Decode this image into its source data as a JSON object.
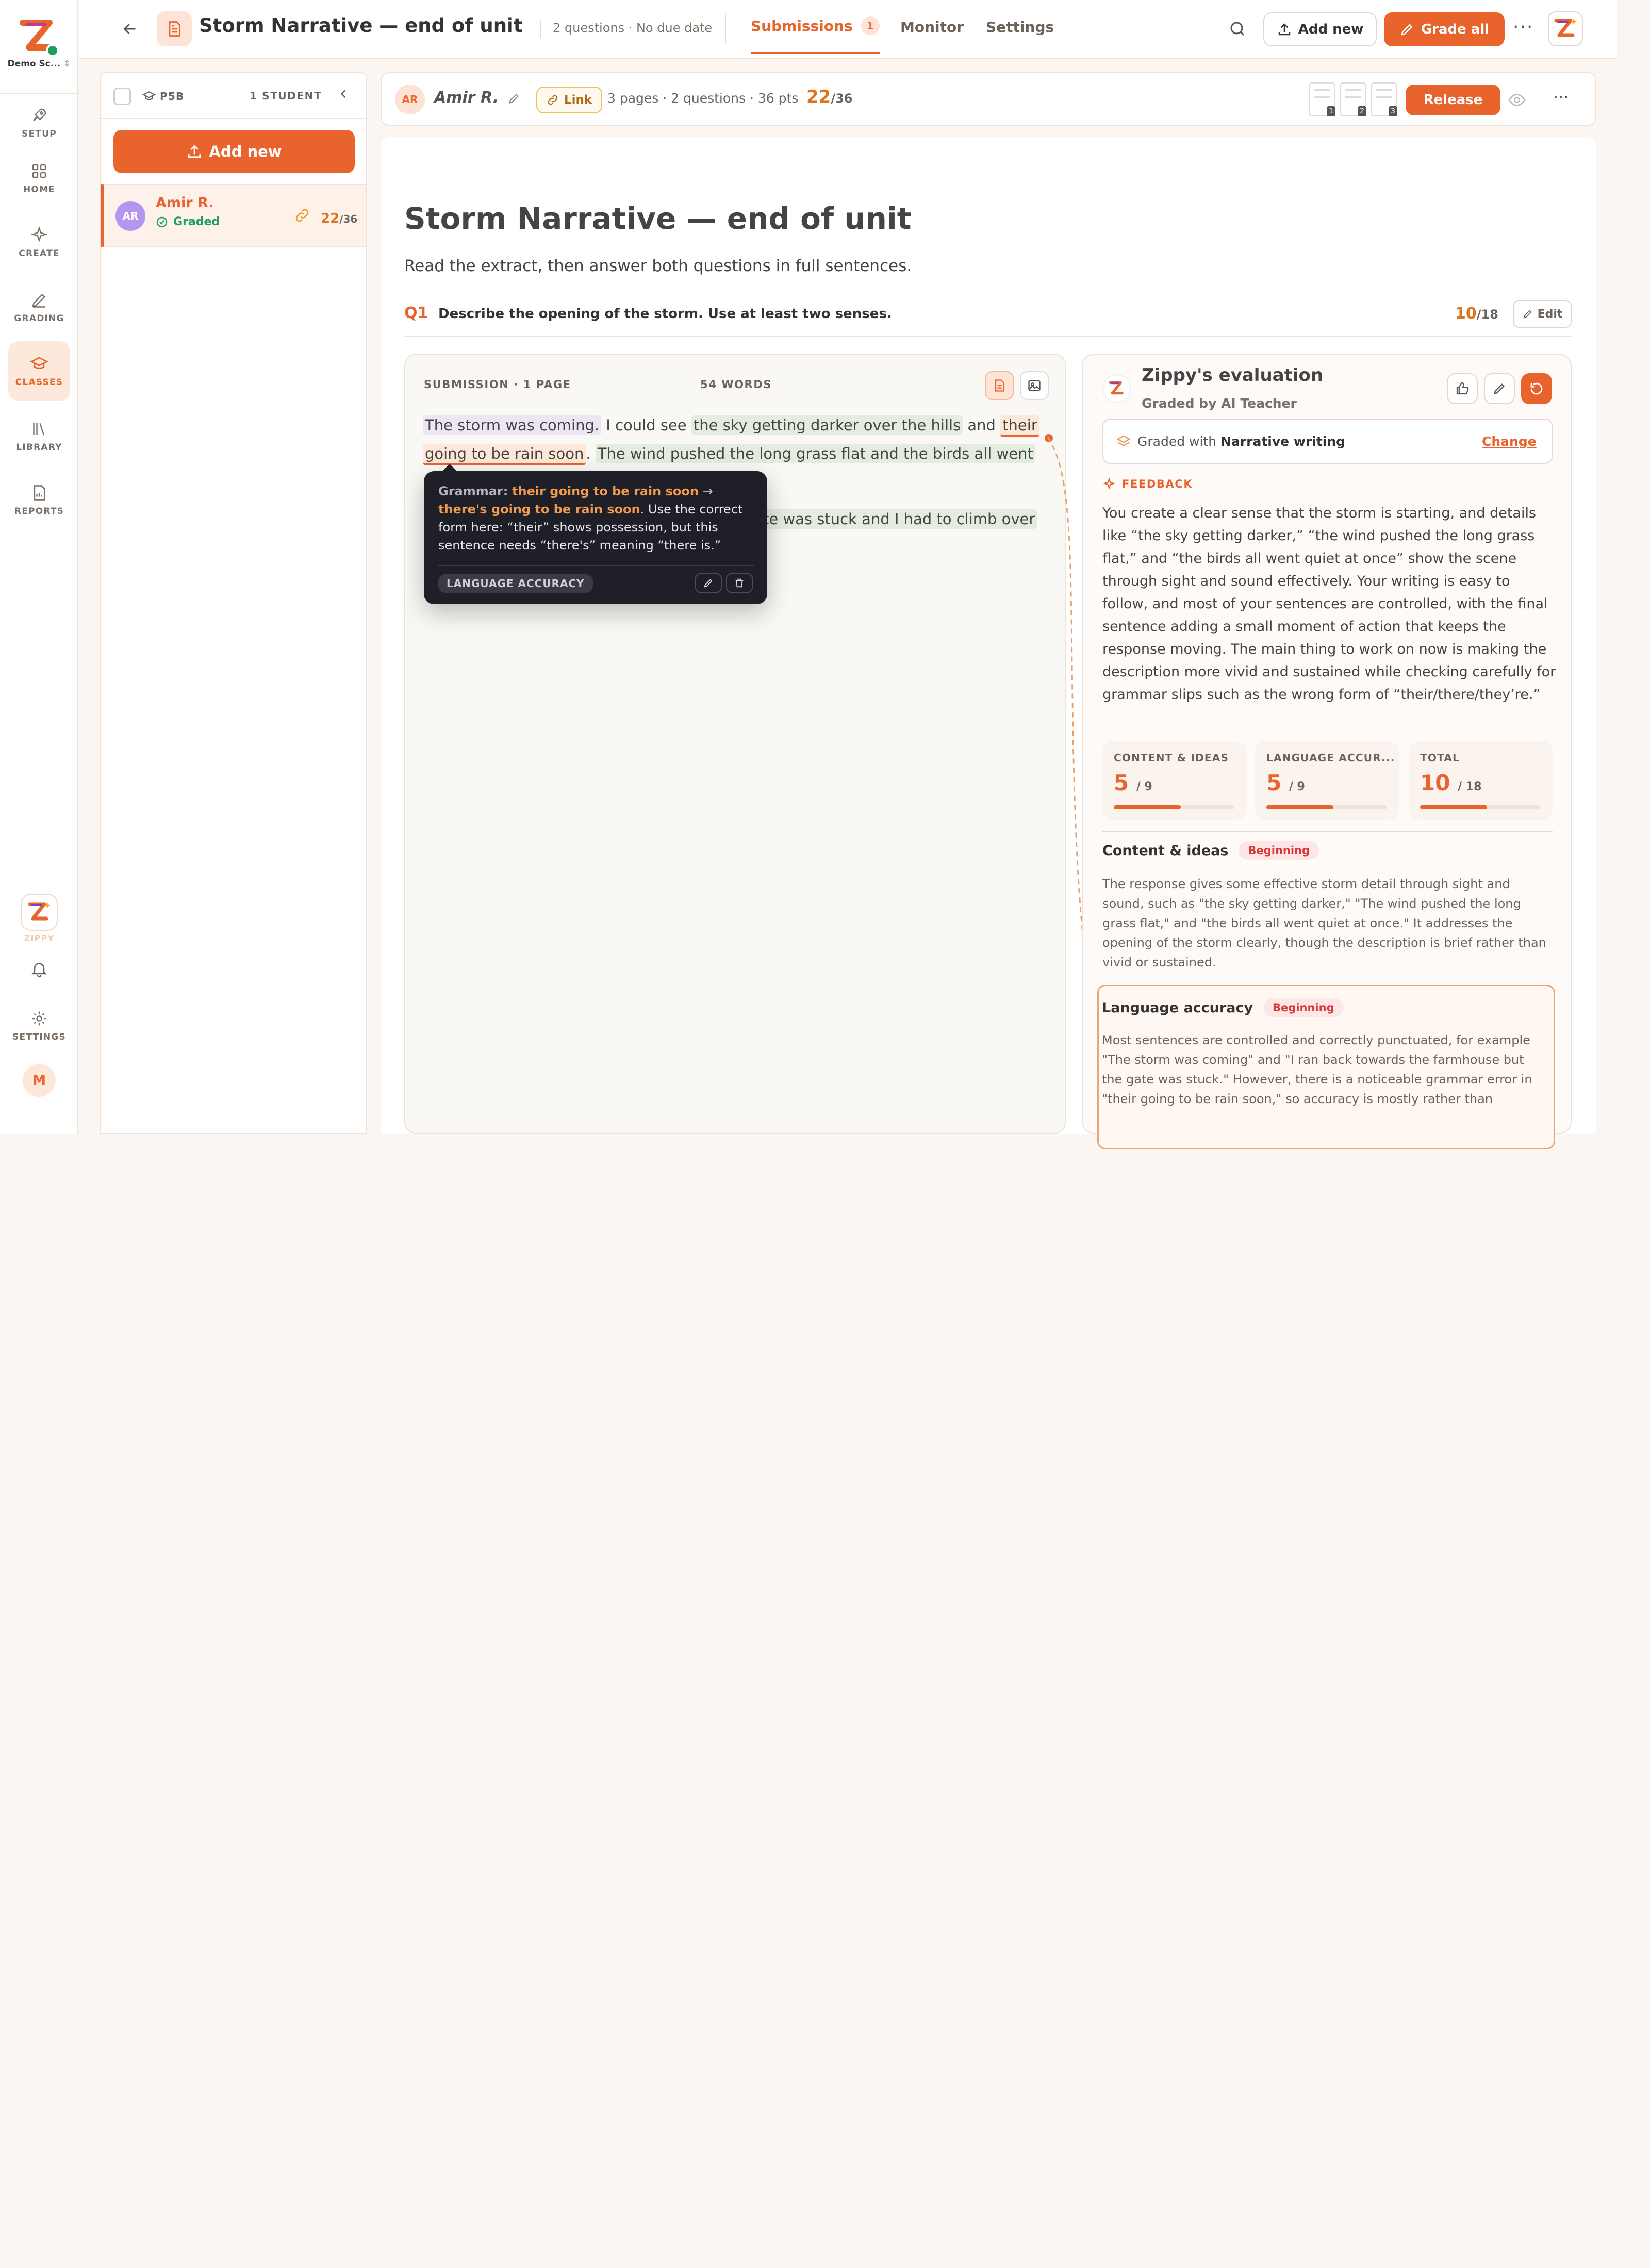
{
  "rail": {
    "org": "Demo Sc...",
    "items": [
      {
        "label": "SETUP",
        "icon": "rocket-icon"
      },
      {
        "label": "HOME",
        "icon": "grid-icon"
      },
      {
        "label": "CREATE",
        "icon": "sparkle-icon"
      },
      {
        "label": "GRADING",
        "icon": "pen-icon"
      },
      {
        "label": "CLASSES",
        "icon": "graduation-cap-icon"
      },
      {
        "label": "LIBRARY",
        "icon": "books-icon"
      },
      {
        "label": "REPORTS",
        "icon": "report-icon"
      }
    ],
    "zippy_label": "ZIPPY",
    "settings_label": "SETTINGS",
    "user_initial": "M"
  },
  "header": {
    "title": "Storm Narrative — end of unit",
    "meta": "2 questions · No due date",
    "tabs": [
      {
        "label": "Submissions",
        "count": "1"
      },
      {
        "label": "Monitor"
      },
      {
        "label": "Settings"
      }
    ],
    "add_new": "Add new",
    "grade_all": "Grade all"
  },
  "students": {
    "class": "P5B",
    "count": "1 STUDENT",
    "add_new": "Add new",
    "list": [
      {
        "initials": "AR",
        "name": "Amir R.",
        "status": "Graded",
        "score": "22",
        "total": "/36"
      }
    ]
  },
  "submission_bar": {
    "initials": "AR",
    "name": "Amir R.",
    "link_label": "Link",
    "meta": "3 pages · 2 questions · 36 pts",
    "score": "22",
    "total": "/36",
    "pages": [
      "1",
      "2",
      "3"
    ],
    "release": "Release"
  },
  "document": {
    "title": "Storm Narrative — end of unit",
    "instructions": "Read the extract, then answer both questions in full sentences.",
    "question_num": "Q1",
    "question_text": "Describe the opening of the storm. Use at least two senses.",
    "q_score": "10",
    "q_total": "/18",
    "edit": "Edit"
  },
  "submission": {
    "label": "SUBMISSION · 1 PAGE",
    "words": "54 WORDS",
    "text": {
      "s1": "The storm was coming.",
      "s2": "I could see",
      "s3": "the sky getting darker over the hills",
      "s4": "and",
      "s5": "their",
      "s6": "going to be rain soon",
      "s7": ".",
      "s8": "The wind pushed the long grass flat and the birds all went",
      "s9": "te was stuck and I had to climb over"
    }
  },
  "tooltip": {
    "prefix": "Grammar:",
    "wrong": "their going to be rain soon",
    "arrow": "→",
    "right": "there's going to be rain soon",
    "explanation": ". Use the correct form here: “their” shows possession, but this sentence needs “there's” meaning “there is.”",
    "tag": "LANGUAGE ACCURACY"
  },
  "evaluation": {
    "title": "Zippy's evaluation",
    "subtitle": "Graded by AI Teacher",
    "rubric_prefix": "Graded with",
    "rubric_name": "Narrative writing",
    "change": "Change",
    "feedback_label": "FEEDBACK",
    "feedback": "You create a clear sense that the storm is starting, and details like “the sky getting darker,” “the wind pushed the long grass flat,” and “the birds all went quiet at once” show the scene through sight and sound effectively. Your writing is easy to follow, and most of your sentences are controlled, with the final sentence adding a small moment of action that keeps the response moving. The main thing to work on now is making the description more vivid and sustained while checking carefully for grammar slips such as the wrong form of “their/there/they’re.”",
    "scores": [
      {
        "label": "CONTENT & IDEAS",
        "value": "5",
        "max": "/ 9",
        "fraction": 0.556
      },
      {
        "label": "LANGUAGE ACCUR...",
        "value": "5",
        "max": "/ 9",
        "fraction": 0.556
      },
      {
        "label": "TOTAL",
        "value": "10",
        "max": "/ 18",
        "fraction": 0.556
      }
    ],
    "criteria": [
      {
        "name": "Content & ideas",
        "level": "Beginning",
        "text": "The response gives some effective storm detail through sight and sound, such as \"the sky getting darker,\" \"The wind pushed the long grass flat,\" and \"the birds all went quiet at once.\" It addresses the opening of the storm clearly, though the description is brief rather than vivid or sustained."
      },
      {
        "name": "Language accuracy",
        "level": "Beginning",
        "text": "Most sentences are controlled and correctly punctuated, for example \"The storm was coming\" and \"I ran back towards the farmhouse but the gate was stuck.\" However, there is a noticeable grammar error in \"their going to be rain soon,\" so accuracy is mostly rather than"
      }
    ]
  },
  "colors": {
    "accent": "#e9632d",
    "graded": "#1f9d63",
    "beginning": "#d33b3b"
  }
}
